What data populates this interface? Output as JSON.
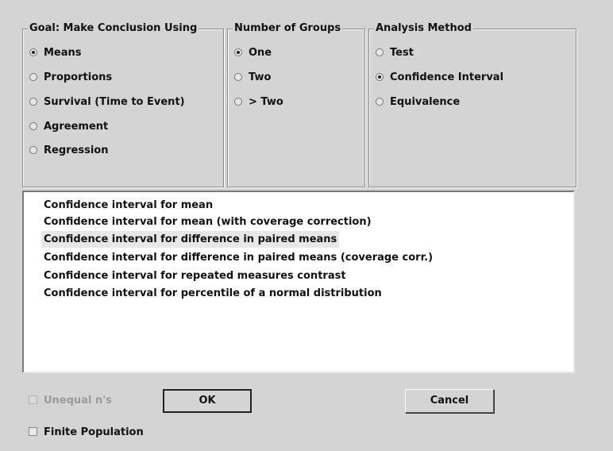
{
  "goal": {
    "title": "Goal: Make Conclusion Using",
    "options": [
      "Means",
      "Proportions",
      "Survival (Time to Event)",
      "Agreement",
      "Regression"
    ],
    "selected": "Means"
  },
  "groups": {
    "title": "Number of Groups",
    "options": [
      "One",
      "Two",
      "> Two"
    ],
    "selected": "One"
  },
  "method": {
    "title": "Analysis Method",
    "options": [
      "Test",
      "Confidence Interval",
      "Equivalence"
    ],
    "selected": "Confidence Interval"
  },
  "procedures": {
    "items": [
      "Confidence interval for mean",
      "Confidence interval for mean (with coverage correction)",
      "Confidence interval for difference in paired means",
      "Confidence interval for difference in paired means (coverage corr.)",
      "Confidence interval for repeated measures contrast",
      "Confidence interval for percentile of a normal distribution"
    ],
    "selected_index": 2
  },
  "options": {
    "unequal_label": "Unequal n's",
    "unequal_checked": false,
    "unequal_enabled": false,
    "finite_label": "Finite Population",
    "finite_checked": false
  },
  "buttons": {
    "ok_label": "OK",
    "cancel_label": "Cancel"
  }
}
